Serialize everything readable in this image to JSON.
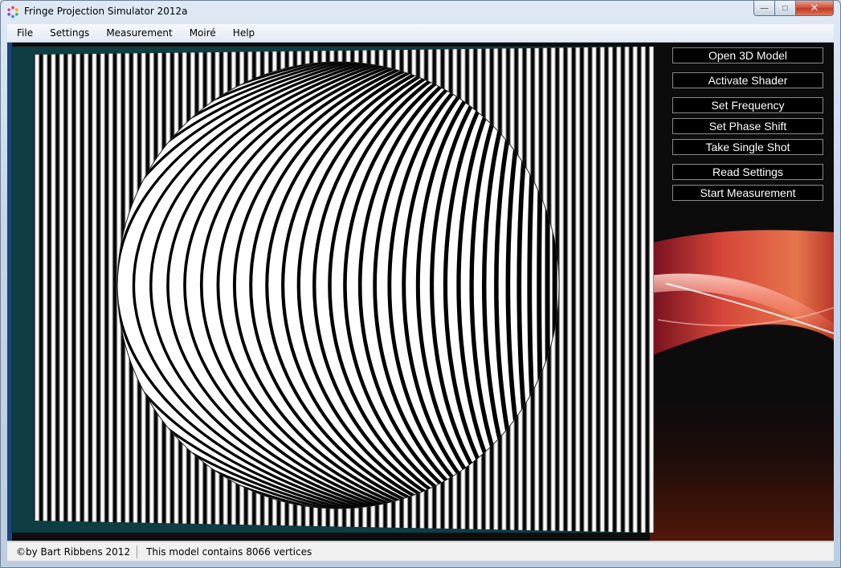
{
  "window": {
    "title": "Fringe Projection Simulator 2012a",
    "controls": {
      "minimize": "—",
      "maximize": "□",
      "close": "✕"
    }
  },
  "menu": [
    "File",
    "Settings",
    "Measurement",
    "Moiré",
    "Help"
  ],
  "buttons": {
    "open_model": "Open 3D Model",
    "activate_shader": "Activate Shader",
    "set_frequency": "Set Frequency",
    "set_phase_shift": "Set Phase Shift",
    "take_single_shot": "Take Single Shot",
    "read_settings": "Read Settings",
    "start_measurement": "Start Measurement"
  },
  "status": {
    "copyright": "©by Bart Ribbens 2012",
    "model_info": "This model contains 8066 vertices"
  },
  "colors": {
    "viewport_background": "#0f3d44",
    "client_background": "#0d0d0d",
    "accent_swoosh": "#e8453a",
    "button_border": "#8a8a8a"
  },
  "icons": {
    "app": "color-wheel-icon"
  }
}
